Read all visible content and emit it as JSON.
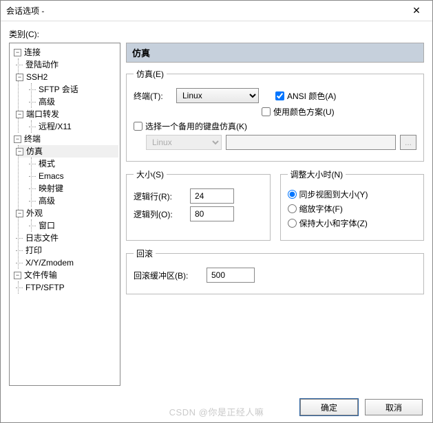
{
  "window": {
    "title": "会话选项 -",
    "close": "✕"
  },
  "category_label": "类别(C):",
  "tree": {
    "n0": "连接",
    "n0_0": "登陆动作",
    "n0_1": "SSH2",
    "n0_1_0": "SFTP 会话",
    "n0_1_1": "高级",
    "n0_2": "端口转发",
    "n0_2_0": "远程/X11",
    "n1": "终端",
    "n1_0": "仿真",
    "n1_0_0": "模式",
    "n1_0_1": "Emacs",
    "n1_0_2": "映射键",
    "n1_0_3": "高级",
    "n1_1": "外观",
    "n1_1_0": "窗口",
    "n1_2": "日志文件",
    "n1_3": "打印",
    "n1_4": "X/Y/Zmodem",
    "n2": "文件传输",
    "n2_0": "FTP/SFTP"
  },
  "panel_title": "仿真",
  "emu": {
    "legend": "仿真(E)",
    "terminal_label": "终端(T):",
    "terminal_value": "Linux",
    "ansi_color": "ANSI 颜色(A)",
    "color_scheme": "使用颜色方案(U)",
    "alt_kbd": "选择一个备用的键盘仿真(K)",
    "alt_value": "Linux"
  },
  "size": {
    "legend": "大小(S)",
    "rows_label": "逻辑行(R):",
    "rows_value": "24",
    "cols_label": "逻辑列(O):",
    "cols_value": "80"
  },
  "resize": {
    "legend": "调整大小时(N)",
    "r1": "同步视图到大小(Y)",
    "r2": "缩放字体(F)",
    "r3": "保持大小和字体(Z)"
  },
  "scroll": {
    "legend": "回滚",
    "buf_label": "回滚缓冲区(B):",
    "buf_value": "500"
  },
  "buttons": {
    "ok": "确定",
    "cancel": "取消"
  },
  "watermark": "CSDN @你是正经人嘛"
}
